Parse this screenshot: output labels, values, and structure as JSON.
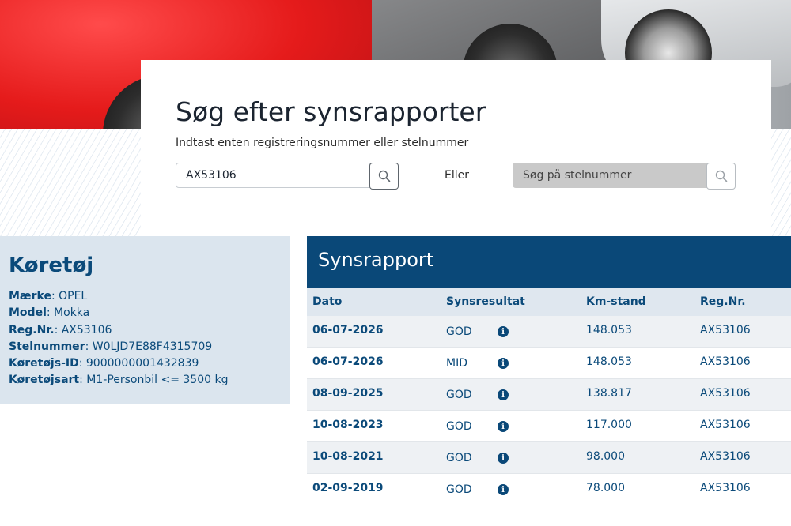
{
  "search": {
    "title": "Søg efter synsrapporter",
    "subtitle": "Indtast enten registreringsnummer eller stelnummer",
    "reg_value": "AX53106",
    "or_label": "Eller",
    "vin_placeholder": "Søg på stelnummer"
  },
  "vehicle": {
    "title": "Køretøj",
    "fields": [
      {
        "label": "Mærke",
        "value": "OPEL"
      },
      {
        "label": "Model",
        "value": "Mokka"
      },
      {
        "label": "Reg.Nr.",
        "value": "AX53106"
      },
      {
        "label": "Stelnummer",
        "value": "W0LJD7E88F4315709"
      },
      {
        "label": "Køretøjs-ID",
        "value": "9000000001432839"
      },
      {
        "label": "Køretøjsart",
        "value": "M1-Personbil <= 3500 kg"
      }
    ]
  },
  "report": {
    "title": "Synsrapport",
    "columns": [
      "Dato",
      "Synsresultat",
      "Km-stand",
      "Reg.Nr."
    ],
    "info_glyph": "i",
    "rows": [
      {
        "date": "06-07-2026",
        "result": "GOD",
        "km": "148.053",
        "reg": "AX53106"
      },
      {
        "date": "06-07-2026",
        "result": "MID",
        "km": "148.053",
        "reg": "AX53106"
      },
      {
        "date": "08-09-2025",
        "result": "GOD",
        "km": "138.817",
        "reg": "AX53106"
      },
      {
        "date": "10-08-2023",
        "result": "GOD",
        "km": "117.000",
        "reg": "AX53106"
      },
      {
        "date": "10-08-2021",
        "result": "GOD",
        "km": "98.000",
        "reg": "AX53106"
      },
      {
        "date": "02-09-2019",
        "result": "GOD",
        "km": "78.000",
        "reg": "AX53106"
      }
    ]
  },
  "colors": {
    "brand": "#0a4878",
    "panel": "#dbe5ee",
    "header_row": "#dfe7ef"
  }
}
